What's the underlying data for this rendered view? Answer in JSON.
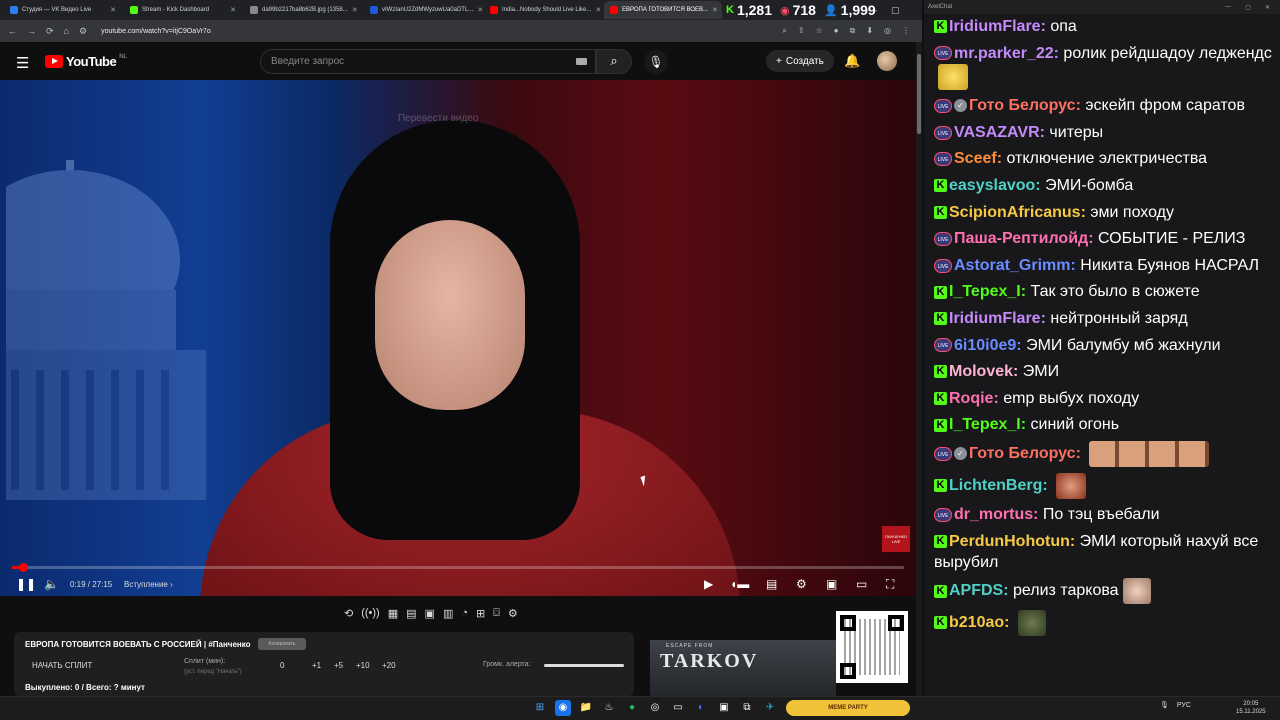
{
  "browser": {
    "tabs": [
      {
        "title": "Студия — VK Видео Live",
        "color": "#2d7cf6",
        "active": false
      },
      {
        "title": "Stream - Kick Dashboard",
        "color": "#53fc18",
        "active": false
      },
      {
        "title": "da99b2217ba8b62B.jpg (1358...",
        "color": "#888888",
        "active": false
      },
      {
        "title": "vIWzIanU2ZdMWyzuwUa0aDTL...",
        "color": "#1e5bd6",
        "active": false
      },
      {
        "title": "India...Nobody Should Live Like...",
        "color": "#ff0000",
        "active": false
      },
      {
        "title": "ЕВРОПА ГОТОВИТСЯ ВОЕВ...",
        "color": "#ff0000",
        "active": true
      }
    ],
    "url": "youtube.com/watch?v=itjC9OaVr7o"
  },
  "stats": {
    "kick": "1,281",
    "live": "718",
    "viewers": "1,999"
  },
  "youtube": {
    "logo_text": "YouTube",
    "region": "NL",
    "search_placeholder": "Введите запрос",
    "create_label": "Создать"
  },
  "video": {
    "translate_label": "Перевести видео",
    "channel_badge": "ПАНЧЕНКО LIVE",
    "time": "0:19 / 27:15",
    "chapter": "Вступление",
    "progress": 0.012
  },
  "panel": {
    "title": "ЕВРОПА ГОТОВИТСЯ ВОЕВАТЬ С РОССИЕЙ | #Панченко",
    "copy_label": "Копировать",
    "split_button": "НАЧАТЬ СПЛИТ",
    "split_label": "Сплит (мин):",
    "split_hint": "(уст. перед \"Начать\")",
    "split_value": "0",
    "increments": [
      "+1",
      "+5",
      "+10",
      "+20"
    ],
    "alert_label": "Громк. алерта:",
    "bought": "Выкуплено: 0 / Всего: ? минут"
  },
  "tarkov": {
    "small": "ESCAPE FROM",
    "big": "TARKOV"
  },
  "chat": {
    "title": "AxelChat",
    "messages": [
      {
        "badges": [
          "kick"
        ],
        "nick": "IridiumFlare:",
        "color": "#c58af9",
        "text": "опа"
      },
      {
        "badges": [
          "live"
        ],
        "nick": "mr.parker_22:",
        "color": "#c58af9",
        "text": "ролик рейдшадоу леджендс",
        "emote": "gold"
      },
      {
        "badges": [
          "live",
          "ver"
        ],
        "nick": "Гото Белорус:",
        "color": "#ff6f61",
        "text": "эскейп фром саратов"
      },
      {
        "badges": [
          "live"
        ],
        "nick": "VASAZAVR:",
        "color": "#c58af9",
        "text": "читеры"
      },
      {
        "badges": [
          "live"
        ],
        "nick": "Sceef:",
        "color": "#ff8c3a",
        "text": "отключение электричества"
      },
      {
        "badges": [
          "kick"
        ],
        "nick": "easyslavoo:",
        "color": "#4fd1c5",
        "text": "ЭМИ-бомба"
      },
      {
        "badges": [
          "kick"
        ],
        "nick": "ScipionAfricanus:",
        "color": "#f6c945",
        "text": "эми походу"
      },
      {
        "badges": [
          "live"
        ],
        "nick": "Паша-Рептилойд:",
        "color": "#ff6fb0",
        "text": "СОБЫТИЕ - РЕЛИЗ"
      },
      {
        "badges": [
          "live"
        ],
        "nick": "Astorat_Grimm:",
        "color": "#6b8cff",
        "text": "Никита Буянов НАСРАЛ"
      },
      {
        "badges": [
          "kick"
        ],
        "nick": "I_Tepex_I:",
        "color": "#53fc18",
        "text": "Так это было в сюжете"
      },
      {
        "badges": [
          "kick"
        ],
        "nick": "IridiumFlare:",
        "color": "#c58af9",
        "text": "нейтронный заряд"
      },
      {
        "badges": [
          "live"
        ],
        "nick": "6i10i0e9:",
        "color": "#6b8cff",
        "text": "ЭМИ балумбу мб жахнули"
      },
      {
        "badges": [
          "kick"
        ],
        "nick": "Molovek:",
        "color": "#ffb3d1",
        "text": "ЭМИ"
      },
      {
        "badges": [
          "kick"
        ],
        "nick": "Roqie:",
        "color": "#ff6fb0",
        "text": "emp выбух походу"
      },
      {
        "badges": [
          "kick"
        ],
        "nick": "I_Tepex_I:",
        "color": "#53fc18",
        "text": "синий огонь"
      },
      {
        "badges": [
          "live",
          "ver"
        ],
        "nick": "Гото Белорус:",
        "color": "#ff6f61",
        "text": "",
        "emote": "faces"
      },
      {
        "badges": [
          "kick"
        ],
        "nick": "LichtenBerg:",
        "color": "#4fd1c5",
        "text": "",
        "emote": "angry"
      },
      {
        "badges": [
          "live"
        ],
        "nick": "dr_mortus:",
        "color": "#ff6fb0",
        "text": "По тэц въебали"
      },
      {
        "badges": [
          "kick"
        ],
        "nick": "PerdunHohotun:",
        "color": "#f6c945",
        "text": "ЭМИ который нахуй все вырубил"
      },
      {
        "badges": [
          "kick"
        ],
        "nick": "APFDS:",
        "color": "#4fd1c5",
        "text": "релиз таркова",
        "emote": "bald"
      },
      {
        "badges": [
          "kick"
        ],
        "nick": "b210ao:",
        "color": "#f6c945",
        "text": "",
        "emote": "frog"
      }
    ]
  },
  "taskbar": {
    "meme": "MEME PARTY",
    "lang": "РУС",
    "time": "20:05",
    "date": "15.11.2025"
  }
}
